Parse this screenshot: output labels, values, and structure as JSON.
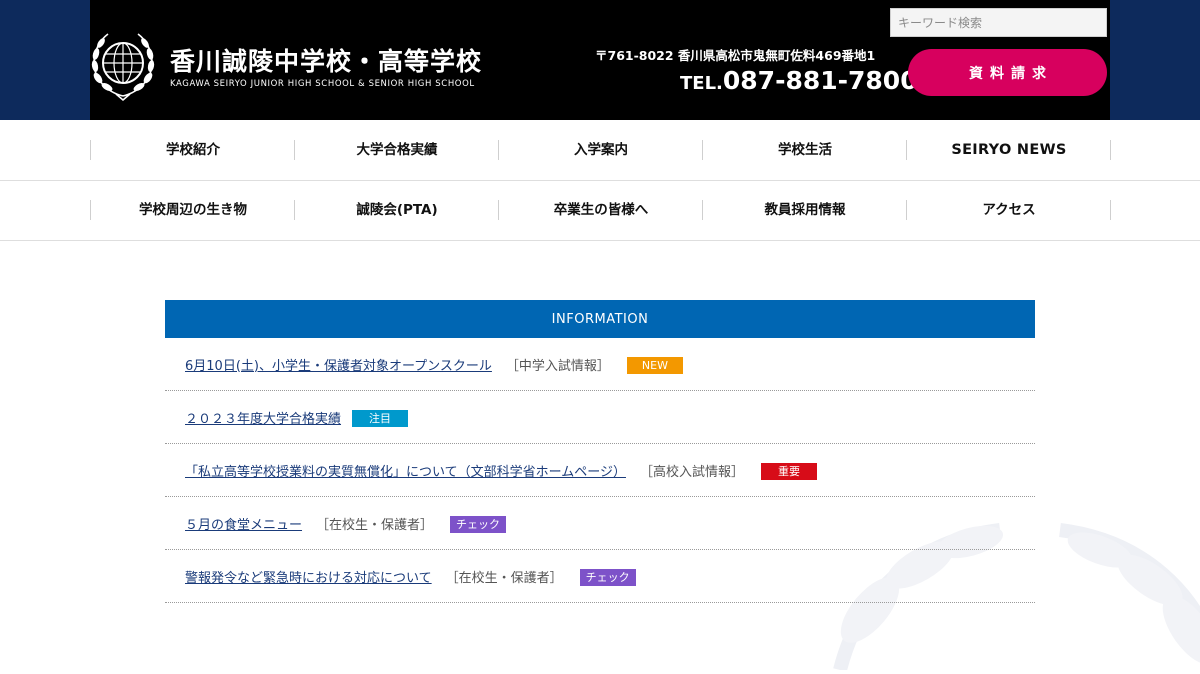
{
  "header": {
    "school_name": "香川誠陵中学校・高等学校",
    "school_name_en": "KAGAWA SEIRYO JUNIOR HIGH SCHOOL & SENIOR HIGH SCHOOL",
    "address": "〒761-8022 香川県高松市鬼無町佐料469番地1",
    "tel_prefix": "TEL.",
    "tel_number": "087-881-7800",
    "search_placeholder": "キーワード検索",
    "request_button": "資料請求"
  },
  "nav": {
    "row1": [
      "学校紹介",
      "大学合格実績",
      "入学案内",
      "学校生活",
      "SEIRYO NEWS"
    ],
    "row2": [
      "学校周辺の生き物",
      "誠陵会(PTA)",
      "卒業生の皆様へ",
      "教員採用情報",
      "アクセス"
    ]
  },
  "information": {
    "title": "INFORMATION",
    "items": [
      {
        "title": "6月10日(土)、小学生・保護者対象オープンスクール",
        "category": "［中学入試情報］",
        "badge": "NEW"
      },
      {
        "title": "２０２３年度大学合格実績",
        "category": "",
        "badge": "注目"
      },
      {
        "title": "「私立高等学校授業料の実質無償化」について（文部科学省ホームページ）",
        "category": "［高校入試情報］",
        "badge": "重要"
      },
      {
        "title": "５月の食堂メニュー",
        "category": "［在校生・保護者］",
        "badge": "チェック"
      },
      {
        "title": "警報発令など緊急時における対応について",
        "category": "［在校生・保護者］",
        "badge": "チェック"
      }
    ]
  },
  "colors": {
    "header_bg": "#000000",
    "band_bg": "#0d2a5c",
    "accent_pink": "#d7005e",
    "info_blue": "#0066b3",
    "badge_new": "#f39800",
    "badge_attention": "#0099cc",
    "badge_important": "#d70c18",
    "badge_check": "#7d52c9"
  },
  "icons": {
    "logo": "school-emblem-icon",
    "watermark": "laurel-watermark-icon"
  }
}
